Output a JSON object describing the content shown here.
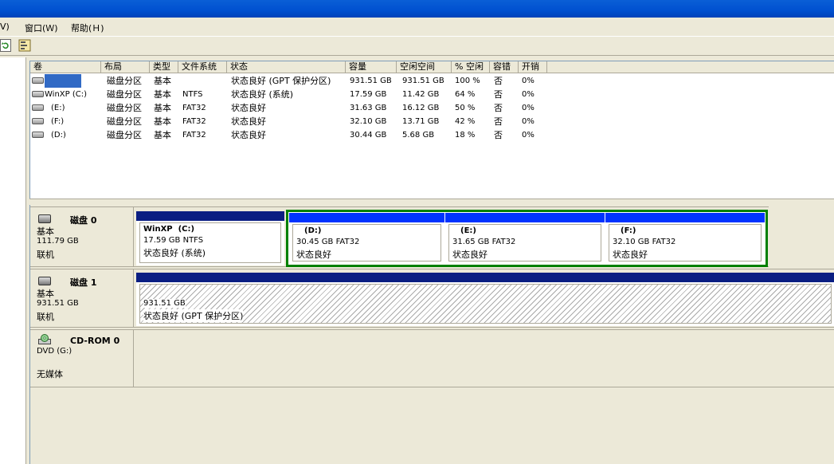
{
  "menu": {
    "partial_view": "Ⅴ)",
    "window": "窗口(Ｗ)",
    "help": "帮助(Ｈ)"
  },
  "toolbar": {
    "refresh_icon": "refresh-icon",
    "properties_icon": "properties-icon"
  },
  "volume_table": {
    "columns": [
      "卷",
      "布局",
      "类型",
      "文件系统",
      "状态",
      "容量",
      "空闲空间",
      "% 空闲",
      "容错",
      "开销"
    ],
    "rows": [
      {
        "name": "",
        "layout": "磁盘分区",
        "type": "基本",
        "fs": "",
        "status": "状态良好 (GPT 保护分区)",
        "capacity": "931.51 GB",
        "free": "931.51 GB",
        "pct": "100 %",
        "ft": "否",
        "overhead": "0%"
      },
      {
        "name": "WinXP (C:)",
        "layout": "磁盘分区",
        "type": "基本",
        "fs": "NTFS",
        "status": "状态良好 (系统)",
        "capacity": "17.59 GB",
        "free": "11.42 GB",
        "pct": "64 %",
        "ft": "否",
        "overhead": "0%"
      },
      {
        "name": "(E:)",
        "layout": "磁盘分区",
        "type": "基本",
        "fs": "FAT32",
        "status": "状态良好",
        "capacity": "31.63 GB",
        "free": "16.12 GB",
        "pct": "50 %",
        "ft": "否",
        "overhead": "0%"
      },
      {
        "name": "(F:)",
        "layout": "磁盘分区",
        "type": "基本",
        "fs": "FAT32",
        "status": "状态良好",
        "capacity": "32.10 GB",
        "free": "13.71 GB",
        "pct": "42 %",
        "ft": "否",
        "overhead": "0%"
      },
      {
        "name": "(D:)",
        "layout": "磁盘分区",
        "type": "基本",
        "fs": "FAT32",
        "status": "状态良好",
        "capacity": "30.44 GB",
        "free": "5.68 GB",
        "pct": "18 %",
        "ft": "否",
        "overhead": "0%"
      }
    ]
  },
  "disks": [
    {
      "title": "磁盘 0",
      "type": "基本",
      "size": "111.79 GB",
      "state": "联机",
      "partitions": [
        {
          "name": "WinXP  (C:)",
          "size": "17.59 GB NTFS",
          "status": "状态良好 (系统)"
        },
        {
          "name": "(D:)",
          "size": "30.45 GB FAT32",
          "status": "状态良好"
        },
        {
          "name": "(E:)",
          "size": "31.65 GB FAT32",
          "status": "状态良好"
        },
        {
          "name": "(F:)",
          "size": "32.10 GB FAT32",
          "status": "状态良好"
        }
      ]
    },
    {
      "title": "磁盘 1",
      "type": "基本",
      "size": "931.51 GB",
      "state": "联机",
      "partitions": [
        {
          "name": "",
          "size": "931.51 GB",
          "status": "状态良好 (GPT 保护分区)"
        }
      ]
    },
    {
      "title": "CD-ROM 0",
      "type": "DVD (G:)",
      "state": "无媒体"
    }
  ],
  "colors": {
    "primary_bar": "#0a1e82",
    "logical_bar": "#0033ff",
    "extended_border": "#008000",
    "selection": "#316ac5"
  }
}
